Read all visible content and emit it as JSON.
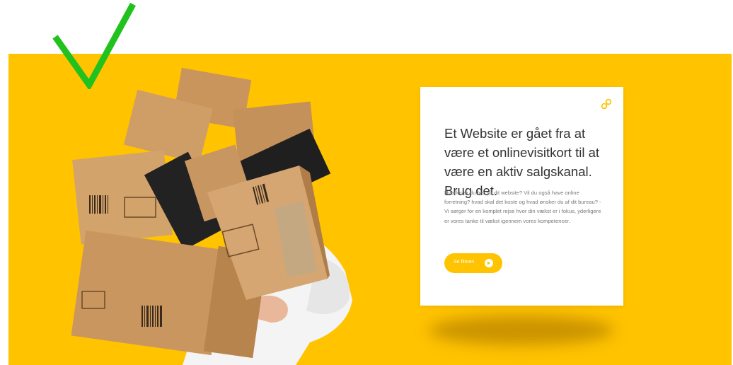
{
  "hero": {
    "headline": "Et Website er gået fra at være et onlinevisitkort til at være en aktiv salgskanal. Brug det.",
    "body": "Hvorfor er du her på dit website? Vil du også have online forretning? hvad skal det koste og hvad ønsker du af dit bureau? - Vi sørger for en komplet rejse hvor din vækst er i fokus, yderligere er vores tanke til vækst igennem vores kompetencer.",
    "cta_label": "Se filmen",
    "icons": [
      "check-mark-icon",
      "link-chain-icon",
      "arrow-right-icon"
    ]
  },
  "colors": {
    "brand_yellow": "#ffc300",
    "check_green": "#22c21e",
    "headline_text": "#333333",
    "body_text": "#7a7a7a"
  }
}
